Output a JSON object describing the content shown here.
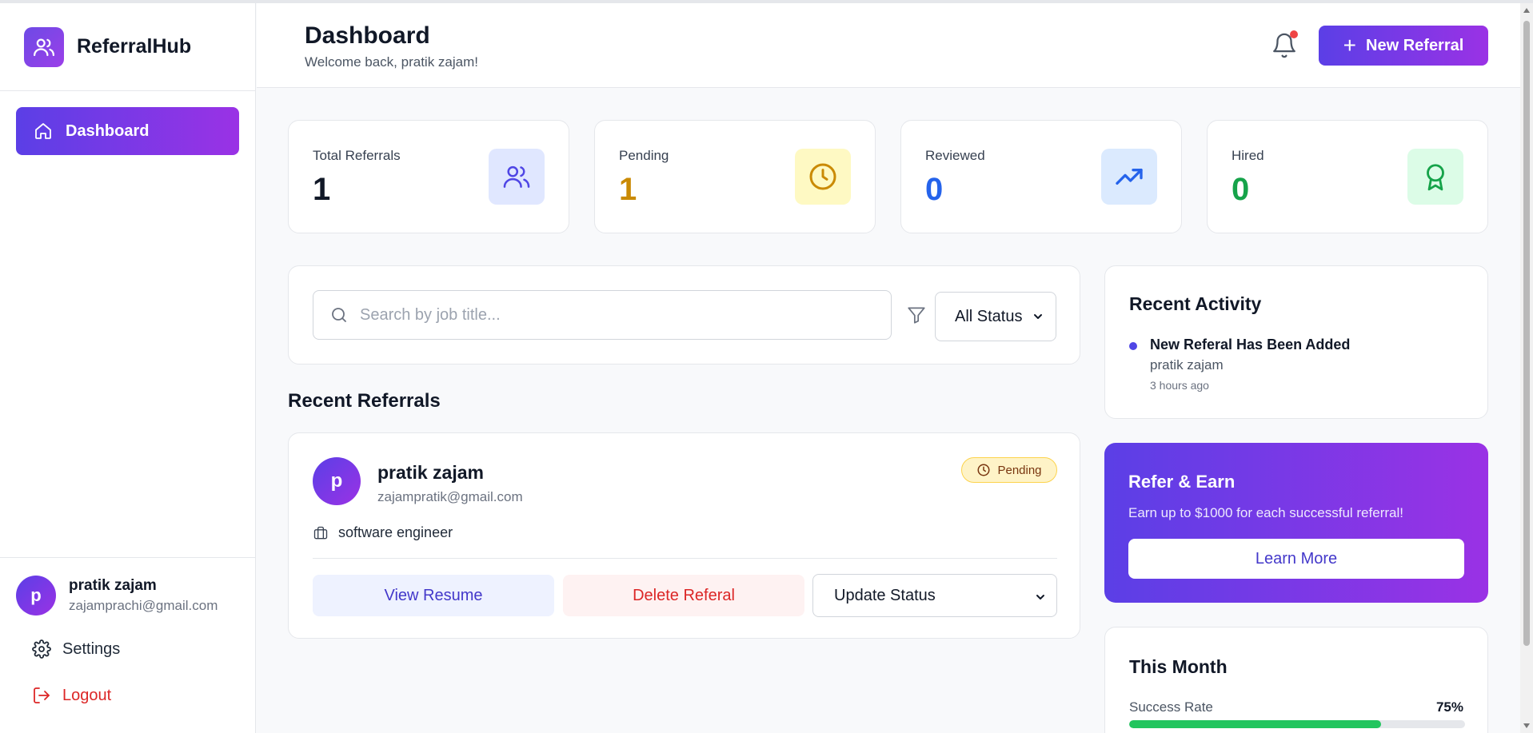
{
  "brand": {
    "name": "ReferralHub",
    "logo_icon": "users-icon"
  },
  "sidebar": {
    "items": [
      {
        "label": "Dashboard",
        "icon": "home-icon",
        "active": true
      }
    ],
    "user": {
      "initial": "p",
      "name": "pratik zajam",
      "email": "zajamprachi@gmail.com"
    },
    "settings_label": "Settings",
    "logout_label": "Logout"
  },
  "header": {
    "title": "Dashboard",
    "welcome": "Welcome back, pratik zajam!",
    "new_referral_label": "New Referral"
  },
  "stats": [
    {
      "label": "Total Referrals",
      "value": "1",
      "color": "#111827",
      "icon": "users-icon",
      "icon_bg": "#e0e7ff"
    },
    {
      "label": "Pending",
      "value": "1",
      "color": "#ca8a04",
      "icon": "clock-icon",
      "icon_bg": "#fef9c3"
    },
    {
      "label": "Reviewed",
      "value": "0",
      "color": "#2563eb",
      "icon": "trending-up-icon",
      "icon_bg": "#dbeafe"
    },
    {
      "label": "Hired",
      "value": "0",
      "color": "#16a34a",
      "icon": "award-icon",
      "icon_bg": "#dcfce7"
    }
  ],
  "search": {
    "placeholder": "Search by job title...",
    "value": ""
  },
  "filter": {
    "selected": "All Status"
  },
  "recent_referrals": {
    "title": "Recent Referrals",
    "items": [
      {
        "initial": "p",
        "name": "pratik zajam",
        "email": "zajampratik@gmail.com",
        "status": "Pending",
        "job": "software engineer",
        "view_label": "View Resume",
        "delete_label": "Delete Referal",
        "update_label": "Update Status"
      }
    ]
  },
  "activity": {
    "title": "Recent Activity",
    "items": [
      {
        "title": "New Referal Has Been Added",
        "user": "pratik zajam",
        "time": "3 hours ago"
      }
    ]
  },
  "earn": {
    "title": "Refer & Earn",
    "text": "Earn up to $1000 for each successful referral!",
    "button": "Learn More"
  },
  "month": {
    "title": "This Month",
    "metrics": [
      {
        "label": "Success Rate",
        "value": "75%",
        "fraction": 0.75
      }
    ]
  },
  "colors": {
    "accent_start": "#5b3fe6",
    "accent_end": "#9a32e5",
    "danger": "#dc2626",
    "success": "#22c55e"
  }
}
